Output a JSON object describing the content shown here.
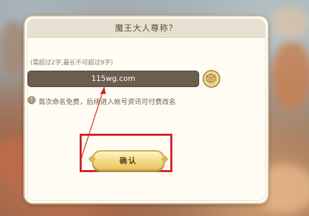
{
  "dialog": {
    "title": "魔王大人尊称？",
    "hint": "(需超过2字,最长不可超过9字)",
    "name_value": "115wg.com",
    "notice_icon": "!",
    "notice": "首次命名免费，后续进入帐号资讯可付费改名",
    "confirm_label": "确认"
  },
  "annotation": {
    "highlight_color": "#d42323",
    "arrow_color": "#d42323"
  },
  "icons": {
    "randomize": "dice-icon",
    "notice": "info-icon"
  }
}
